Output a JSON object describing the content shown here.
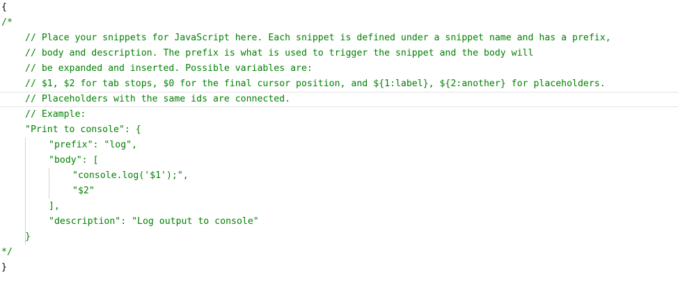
{
  "editor": {
    "lines": [
      "{",
      "/*",
      "// Place your snippets for JavaScript here. Each snippet is defined under a snippet name and has a prefix,",
      "// body and description. The prefix is what is used to trigger the snippet and the body will",
      "// be expanded and inserted. Possible variables are:",
      "// $1, $2 for tab stops, $0 for the final cursor position, and ${1:label}, ${2:another} for placeholders.",
      "// Placeholders with the same ids are connected.",
      "// Example:",
      "\"Print to console\": {",
      "\"prefix\": \"log\",",
      "\"body\": [",
      "\"console.log('$1');\",",
      "\"$2\"",
      "],",
      "\"description\": \"Log output to console\"",
      "}",
      "*/",
      "}"
    ],
    "colors": {
      "background": "#ffffff",
      "comment": "#008000",
      "brace": "#000000",
      "indent_guide": "#d3d3d3",
      "current_line_border": "#e4e4e4"
    }
  }
}
